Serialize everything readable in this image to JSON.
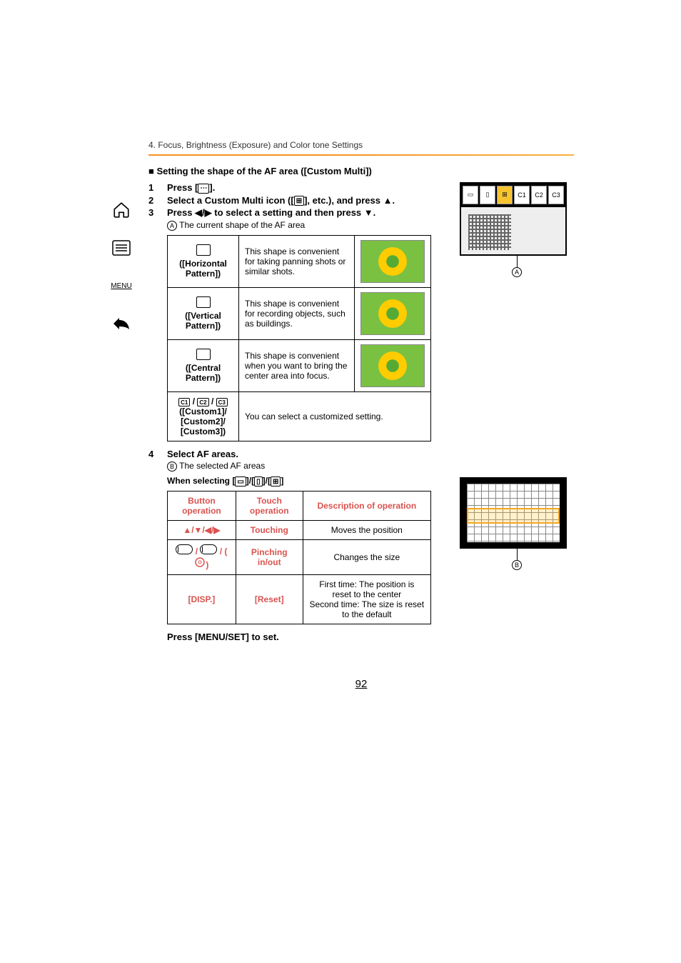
{
  "breadcrumb": "4. Focus, Brightness (Exposure) and Color tone Settings",
  "section_title": "Setting the shape of the AF area ([Custom Multi])",
  "sidebar": {
    "menu_label": "MENU"
  },
  "steps": {
    "s1": {
      "num": "1",
      "text_a": "Press [",
      "text_b": "]."
    },
    "s2": {
      "num": "2",
      "text_a": "Select a Custom Multi icon ([",
      "text_b": "], etc.), and press ",
      "text_c": "."
    },
    "s3": {
      "num": "3",
      "text_a": "Press ",
      "text_b": " to select a setting and then press ",
      "text_c": "."
    },
    "s3_sub_label": "A",
    "s3_sub_text": "The current shape of the AF area",
    "s4": {
      "num": "4",
      "text": "Select AF areas."
    },
    "s4_sub_label": "B",
    "s4_sub_text": "The selected AF areas",
    "s4_when_a": "When selecting [",
    "s4_when_b": "]/[",
    "s4_when_c": "]/[",
    "s4_when_d": "]"
  },
  "patterns": {
    "p1": {
      "name": "([Horizontal Pattern])",
      "desc": "This shape is convenient for taking panning shots or similar shots."
    },
    "p2": {
      "name": "([Vertical Pattern])",
      "desc": "This shape is convenient for recording objects, such as buildings."
    },
    "p3": {
      "name": "([Central Pattern])",
      "desc": "This shape is convenient when you want to bring the center area into focus."
    },
    "p4": {
      "name_a": "([Custom1]/",
      "name_b": "[Custom2]/",
      "name_c": "[Custom3])",
      "c1": "C1",
      "c2": "C2",
      "c3": "C3",
      "desc": "You can select a customized setting."
    }
  },
  "ops_table": {
    "h1": "Button operation",
    "h2": "Touch operation",
    "h3": "Description of operation",
    "r1": {
      "btn": "▲/▼/◀/▶",
      "touch": "Touching",
      "desc": "Moves the position"
    },
    "r2": {
      "touch": "Pinching in/out",
      "desc": "Changes the size"
    },
    "r3": {
      "btn": "[DISP.]",
      "touch": "[Reset]",
      "desc": "First time: The position is reset to the center\nSecond time: The size is reset to the default"
    }
  },
  "screen_tabs": {
    "c1": "C1",
    "c2": "C2",
    "c3": "C3"
  },
  "callout_a": "A",
  "callout_b": "B",
  "footer_note": "Press [MENU/SET] to set.",
  "page_number": "92"
}
